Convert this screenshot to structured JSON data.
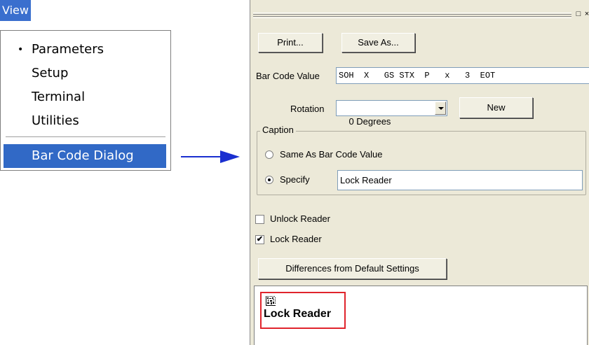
{
  "view_menu": {
    "title": "View",
    "items": [
      {
        "label": "Parameters",
        "bullet": "•"
      },
      {
        "label": "Setup"
      },
      {
        "label": "Terminal"
      },
      {
        "label": "Utilities"
      },
      {
        "label": "Bar Code Dialog"
      }
    ]
  },
  "dialog": {
    "buttons": {
      "print": "Print...",
      "save_as": "Save As...",
      "new": "New",
      "differences": "Differences from Default Settings"
    },
    "titlebar_buttons": {
      "restore": "□",
      "close": "×"
    },
    "barcode_value_label": "Bar Code Value",
    "barcode_value": "SOH  X   GS STX  P   x   3  EOT",
    "rotation_label": "Rotation",
    "rotation_value": "0 Degrees",
    "caption": {
      "legend": "Caption",
      "same_as_label": "Same As Bar Code Value",
      "specify_label": "Specify",
      "specify_value": "Lock Reader",
      "selected": "specify"
    },
    "checkboxes": [
      {
        "label": "Unlock Reader",
        "checked": false,
        "mark": ""
      },
      {
        "label": "Lock Reader",
        "checked": true,
        "mark": "✔"
      }
    ],
    "preview_caption": "Lock Reader"
  },
  "colors": {
    "menu_highlight": "#3169c6",
    "arrow": "#1a2fd0",
    "preview_border": "#e0242c",
    "dialog_bg": "#ece9d8"
  }
}
